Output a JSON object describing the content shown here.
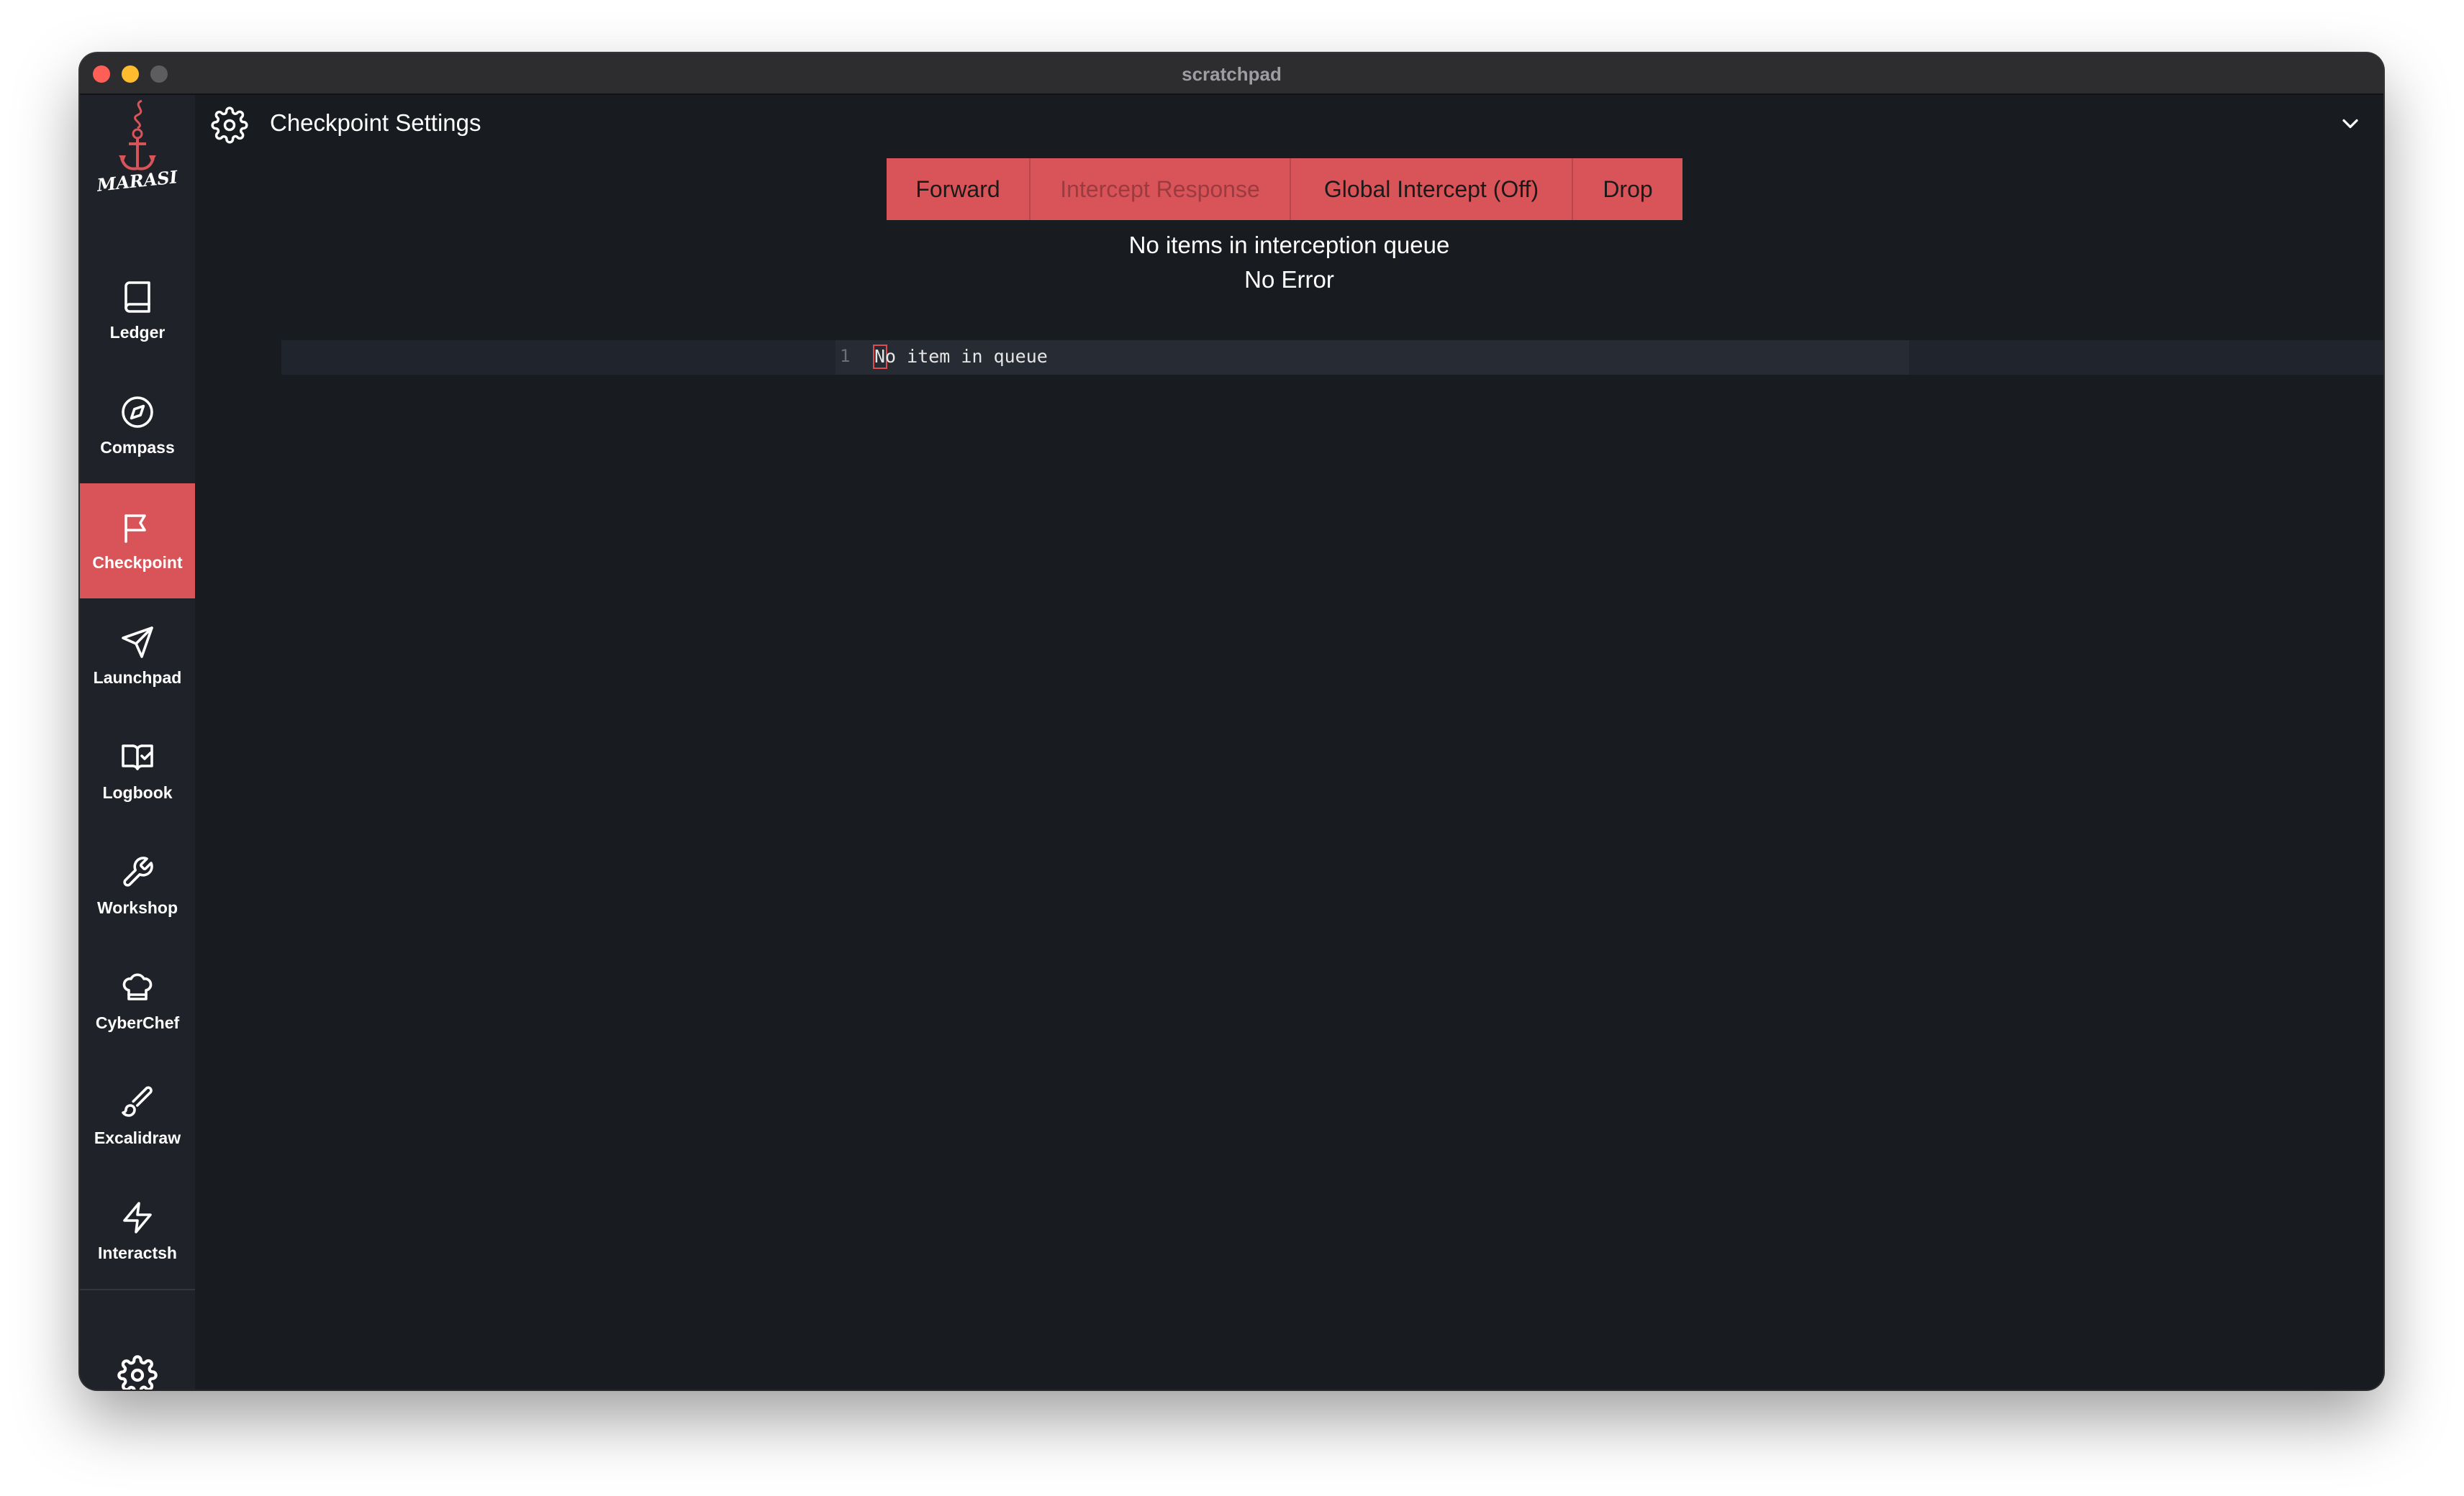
{
  "window": {
    "title": "scratchpad"
  },
  "sidebar": {
    "brand": "MARASI",
    "items": [
      {
        "label": "Ledger",
        "icon": "book-icon",
        "active": false
      },
      {
        "label": "Compass",
        "icon": "compass-icon",
        "active": false
      },
      {
        "label": "Checkpoint",
        "icon": "flag-icon",
        "active": true
      },
      {
        "label": "Launchpad",
        "icon": "send-icon",
        "active": false
      },
      {
        "label": "Logbook",
        "icon": "book-check-icon",
        "active": false
      },
      {
        "label": "Workshop",
        "icon": "wrench-icon",
        "active": false
      },
      {
        "label": "CyberChef",
        "icon": "chef-hat-icon",
        "active": false
      },
      {
        "label": "Excalidraw",
        "icon": "brush-icon",
        "active": false
      },
      {
        "label": "Interactsh",
        "icon": "zap-icon",
        "active": false
      }
    ],
    "settings_icon": "gear-icon"
  },
  "header": {
    "title": "Checkpoint Settings",
    "icon": "gear-icon",
    "toggle_icon": "chevron-down-icon"
  },
  "toolbar": {
    "forward": "Forward",
    "intercept_response": "Intercept Response",
    "global_intercept": "Global Intercept (Off)",
    "drop": "Drop"
  },
  "status": {
    "queue": "No items in interception queue",
    "error": "No Error"
  },
  "editor": {
    "line_number": "1",
    "content": "No item in queue"
  },
  "colors": {
    "accent": "#d95459",
    "background": "#181b20",
    "sidebar": "#1f2228"
  }
}
